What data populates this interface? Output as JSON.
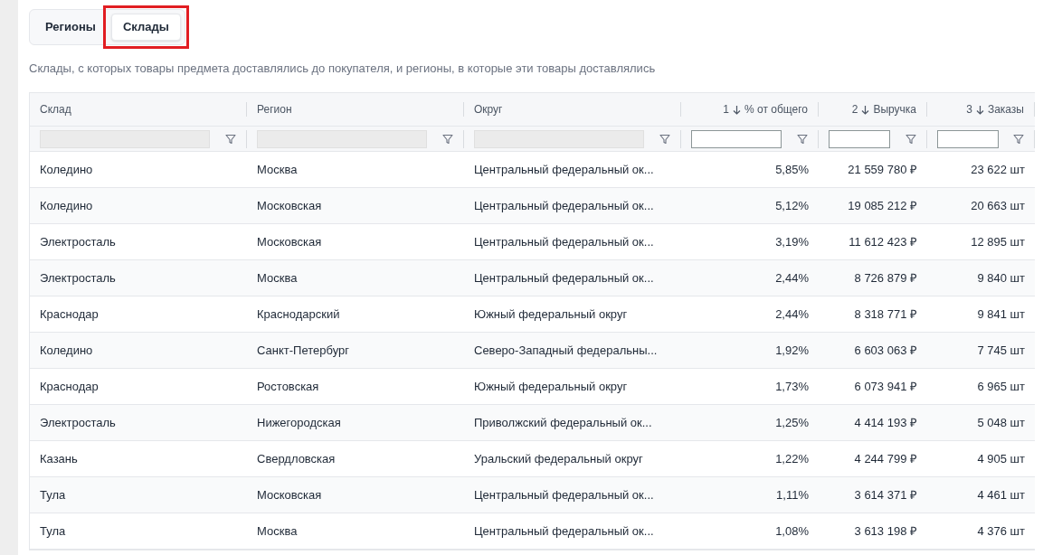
{
  "tabs": [
    {
      "label": "Регионы",
      "selected": false
    },
    {
      "label": "Склады",
      "selected": true
    }
  ],
  "description": "Склады, с которых товары предмета доставлялись до покупателя, и регионы, в которые эти товары доставлялись",
  "table": {
    "columns": [
      {
        "label": "Склад",
        "filter_disabled": true
      },
      {
        "label": "Регион",
        "filter_disabled": true
      },
      {
        "label": "Округ",
        "filter_disabled": true
      },
      {
        "label": "% от общего",
        "sort_rank": "1",
        "filter_disabled": false
      },
      {
        "label": "Выручка",
        "sort_rank": "2",
        "filter_disabled": false
      },
      {
        "label": "Заказы",
        "sort_rank": "3",
        "filter_disabled": false
      }
    ],
    "rows": [
      [
        "Коледино",
        "Москва",
        "Центральный федеральный ок...",
        "5,85%",
        "21 559 780 ₽",
        "23 622 шт"
      ],
      [
        "Коледино",
        "Московская",
        "Центральный федеральный ок...",
        "5,12%",
        "19 085 212 ₽",
        "20 663 шт"
      ],
      [
        "Электросталь",
        "Московская",
        "Центральный федеральный ок...",
        "3,19%",
        "11 612 423 ₽",
        "12 895 шт"
      ],
      [
        "Электросталь",
        "Москва",
        "Центральный федеральный ок...",
        "2,44%",
        "8 726 879 ₽",
        "9 840 шт"
      ],
      [
        "Краснодар",
        "Краснодарский",
        "Южный федеральный округ",
        "2,44%",
        "8 318 771 ₽",
        "9 841 шт"
      ],
      [
        "Коледино",
        "Санкт-Петербург",
        "Северо-Западный федеральны...",
        "1,92%",
        "6 603 063 ₽",
        "7 745 шт"
      ],
      [
        "Краснодар",
        "Ростовская",
        "Южный федеральный округ",
        "1,73%",
        "6 073 941 ₽",
        "6 965 шт"
      ],
      [
        "Электросталь",
        "Нижегородская",
        "Приволжский федеральный ок...",
        "1,25%",
        "4 414 193 ₽",
        "5 048 шт"
      ],
      [
        "Казань",
        "Свердловская",
        "Уральский федеральный округ",
        "1,22%",
        "4 244 799 ₽",
        "4 905 шт"
      ],
      [
        "Тула",
        "Московская",
        "Центральный федеральный ок...",
        "1,11%",
        "3 614 371 ₽",
        "4 461 шт"
      ],
      [
        "Тула",
        "Москва",
        "Центральный федеральный ок...",
        "1,08%",
        "3 613 198 ₽",
        "4 376 шт"
      ]
    ]
  }
}
